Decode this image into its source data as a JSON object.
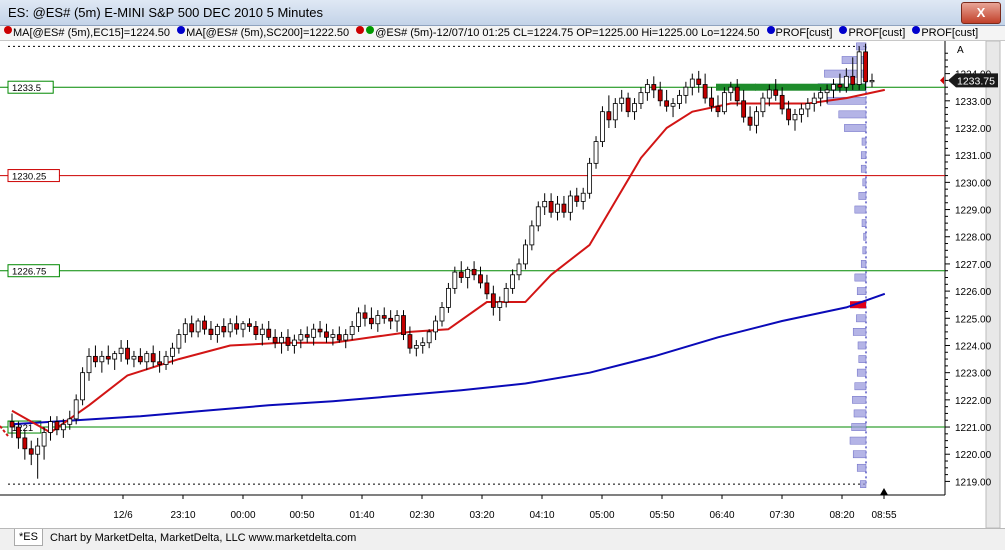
{
  "window": {
    "title": "ES: @ES# (5m) E-MINI S&P 500 DEC 2010 5 Minutes",
    "close_label": "X"
  },
  "legend": {
    "items": [
      {
        "color": "#cc0000",
        "text": "MA[@ES# (5m),EC15]=1224.50"
      },
      {
        "color": "#0000cc",
        "text": "MA[@ES# (5m),SC200]=1222.50"
      },
      {
        "color": "#cc0000",
        "color2": "#009900",
        "text": "@ES# (5m)-12/07/10 01:25 CL=1224.75 OP=1225.00 Hi=1225.00 Lo=1224.50"
      },
      {
        "color": "#0000cc",
        "text": "PROF[cust]"
      },
      {
        "color": "#0000cc",
        "text": "PROF[cust]"
      },
      {
        "color": "#0000cc",
        "text": "PROF[cust]"
      }
    ]
  },
  "status": {
    "tab_label": "*ES",
    "credit": "Chart by MarketDelta, MarketDelta, LLC www.marketdelta.com"
  },
  "chart_data": {
    "type": "candlestick",
    "y_tick_labels": [
      "1219.00",
      "1220.00",
      "1221.00",
      "1222.00",
      "1223.00",
      "1224.00",
      "1225.00",
      "1226.00",
      "1227.00",
      "1228.00",
      "1229.00",
      "1230.00",
      "1231.00",
      "1232.00",
      "1233.00",
      "1234.00"
    ],
    "ylim": [
      1218.5,
      1235.2
    ],
    "x_tick_labels": [
      "12/6",
      "23:10",
      "00:00",
      "00:50",
      "01:40",
      "02:30",
      "03:20",
      "04:10",
      "05:00",
      "05:50",
      "06:40",
      "07:30",
      "08:20",
      "08:55"
    ],
    "current_price": "1233.75",
    "corner_label": "A",
    "horizontal_levels": [
      {
        "label": "1233.5",
        "value": 1233.5,
        "color": "#008800"
      },
      {
        "label": "1230.25",
        "value": 1230.25,
        "color": "#cc0000"
      },
      {
        "label": "1226.75",
        "value": 1226.75,
        "color": "#008800"
      },
      {
        "label": "1221",
        "value": 1221.0,
        "color": "#008800"
      }
    ],
    "dotted_levels": [
      1218.9,
      1235.0
    ],
    "candles": [
      [
        1221.2,
        1221.5,
        1220.6,
        1221.0
      ],
      [
        1221.0,
        1221.2,
        1220.2,
        1220.6
      ],
      [
        1220.6,
        1220.9,
        1219.8,
        1220.2
      ],
      [
        1220.2,
        1220.5,
        1219.6,
        1220.0
      ],
      [
        1220.0,
        1220.6,
        1219.1,
        1220.3
      ],
      [
        1220.3,
        1221.0,
        1219.8,
        1220.8
      ],
      [
        1220.8,
        1221.4,
        1220.5,
        1221.2
      ],
      [
        1221.2,
        1221.4,
        1220.7,
        1220.9
      ],
      [
        1220.9,
        1221.3,
        1220.6,
        1221.1
      ],
      [
        1221.1,
        1221.6,
        1220.9,
        1221.3
      ],
      [
        1221.3,
        1222.2,
        1221.1,
        1222.0
      ],
      [
        1222.0,
        1223.2,
        1221.8,
        1223.0
      ],
      [
        1223.0,
        1223.9,
        1222.7,
        1223.6
      ],
      [
        1223.6,
        1224.0,
        1223.2,
        1223.4
      ],
      [
        1223.4,
        1223.8,
        1223.0,
        1223.6
      ],
      [
        1223.6,
        1224.0,
        1223.3,
        1223.5
      ],
      [
        1223.5,
        1223.8,
        1223.1,
        1223.7
      ],
      [
        1223.7,
        1224.2,
        1223.4,
        1223.9
      ],
      [
        1223.9,
        1224.2,
        1223.3,
        1223.5
      ],
      [
        1223.5,
        1223.8,
        1223.2,
        1223.6
      ],
      [
        1223.6,
        1223.9,
        1223.3,
        1223.4
      ],
      [
        1223.4,
        1223.8,
        1223.1,
        1223.7
      ],
      [
        1223.7,
        1224.0,
        1223.2,
        1223.4
      ],
      [
        1223.4,
        1223.8,
        1223.0,
        1223.3
      ],
      [
        1223.3,
        1223.8,
        1223.1,
        1223.6
      ],
      [
        1223.6,
        1224.1,
        1223.3,
        1223.9
      ],
      [
        1223.9,
        1224.6,
        1223.7,
        1224.4
      ],
      [
        1224.4,
        1225.0,
        1224.1,
        1224.8
      ],
      [
        1224.8,
        1225.1,
        1224.3,
        1224.5
      ],
      [
        1224.5,
        1225.0,
        1224.3,
        1224.9
      ],
      [
        1224.9,
        1225.1,
        1224.4,
        1224.6
      ],
      [
        1224.6,
        1224.9,
        1224.2,
        1224.4
      ],
      [
        1224.4,
        1224.8,
        1224.1,
        1224.7
      ],
      [
        1224.7,
        1225.0,
        1224.3,
        1224.5
      ],
      [
        1224.5,
        1225.0,
        1224.3,
        1224.8
      ],
      [
        1224.8,
        1225.1,
        1224.4,
        1224.6
      ],
      [
        1224.6,
        1224.9,
        1224.3,
        1224.8
      ],
      [
        1224.8,
        1225.0,
        1224.5,
        1224.7
      ],
      [
        1224.7,
        1224.9,
        1224.2,
        1224.4
      ],
      [
        1224.4,
        1224.8,
        1224.0,
        1224.6
      ],
      [
        1224.6,
        1224.9,
        1224.2,
        1224.3
      ],
      [
        1224.3,
        1224.6,
        1223.9,
        1224.1
      ],
      [
        1224.1,
        1224.5,
        1223.7,
        1224.3
      ],
      [
        1224.3,
        1224.6,
        1223.8,
        1224.0
      ],
      [
        1224.0,
        1224.4,
        1223.7,
        1224.2
      ],
      [
        1224.2,
        1224.6,
        1223.9,
        1224.4
      ],
      [
        1224.4,
        1224.7,
        1224.1,
        1224.3
      ],
      [
        1224.3,
        1224.8,
        1224.0,
        1224.6
      ],
      [
        1224.6,
        1224.9,
        1224.3,
        1224.5
      ],
      [
        1224.5,
        1224.8,
        1224.1,
        1224.3
      ],
      [
        1224.3,
        1224.6,
        1224.0,
        1224.4
      ],
      [
        1224.4,
        1224.7,
        1224.1,
        1224.2
      ],
      [
        1224.2,
        1224.6,
        1223.9,
        1224.4
      ],
      [
        1224.4,
        1224.9,
        1224.2,
        1224.7
      ],
      [
        1224.7,
        1225.4,
        1224.5,
        1225.2
      ],
      [
        1225.2,
        1225.5,
        1224.7,
        1225.0
      ],
      [
        1225.0,
        1225.4,
        1224.6,
        1224.8
      ],
      [
        1224.8,
        1225.3,
        1224.5,
        1225.1
      ],
      [
        1225.1,
        1225.4,
        1224.8,
        1225.0
      ],
      [
        1225.0,
        1225.3,
        1224.6,
        1224.9
      ],
      [
        1224.9,
        1225.3,
        1224.5,
        1225.1
      ],
      [
        1225.1,
        1225.3,
        1224.2,
        1224.4
      ],
      [
        1224.4,
        1224.7,
        1223.7,
        1223.9
      ],
      [
        1223.9,
        1224.2,
        1223.6,
        1224.0
      ],
      [
        1224.0,
        1224.3,
        1223.7,
        1224.1
      ],
      [
        1224.1,
        1224.6,
        1223.9,
        1224.5
      ],
      [
        1224.5,
        1225.1,
        1224.2,
        1224.9
      ],
      [
        1224.9,
        1225.6,
        1224.7,
        1225.4
      ],
      [
        1225.4,
        1226.3,
        1225.2,
        1226.1
      ],
      [
        1226.1,
        1226.9,
        1225.9,
        1226.7
      ],
      [
        1226.7,
        1227.1,
        1226.3,
        1226.5
      ],
      [
        1226.5,
        1226.9,
        1226.1,
        1226.8
      ],
      [
        1226.8,
        1227.1,
        1226.4,
        1226.6
      ],
      [
        1226.6,
        1226.9,
        1226.1,
        1226.3
      ],
      [
        1226.3,
        1226.6,
        1225.7,
        1225.9
      ],
      [
        1225.9,
        1226.2,
        1225.1,
        1225.4
      ],
      [
        1225.4,
        1225.8,
        1224.9,
        1225.6
      ],
      [
        1225.6,
        1226.3,
        1225.4,
        1226.1
      ],
      [
        1226.1,
        1226.8,
        1225.9,
        1226.6
      ],
      [
        1226.6,
        1227.2,
        1226.4,
        1227.0
      ],
      [
        1227.0,
        1227.9,
        1226.8,
        1227.7
      ],
      [
        1227.7,
        1228.6,
        1227.5,
        1228.4
      ],
      [
        1228.4,
        1229.3,
        1228.2,
        1229.1
      ],
      [
        1229.1,
        1229.6,
        1228.8,
        1229.3
      ],
      [
        1229.3,
        1229.6,
        1228.7,
        1228.9
      ],
      [
        1228.9,
        1229.5,
        1228.6,
        1229.2
      ],
      [
        1229.2,
        1229.5,
        1228.7,
        1228.9
      ],
      [
        1228.9,
        1229.7,
        1228.6,
        1229.5
      ],
      [
        1229.5,
        1229.8,
        1229.1,
        1229.3
      ],
      [
        1229.3,
        1229.8,
        1229.0,
        1229.6
      ],
      [
        1229.6,
        1230.9,
        1229.4,
        1230.7
      ],
      [
        1230.7,
        1231.7,
        1230.5,
        1231.5
      ],
      [
        1231.5,
        1232.8,
        1231.3,
        1232.6
      ],
      [
        1232.6,
        1233.2,
        1232.0,
        1232.3
      ],
      [
        1232.3,
        1233.1,
        1232.0,
        1232.9
      ],
      [
        1232.9,
        1233.4,
        1232.6,
        1233.1
      ],
      [
        1233.1,
        1233.3,
        1232.4,
        1232.6
      ],
      [
        1232.6,
        1233.1,
        1232.3,
        1232.9
      ],
      [
        1232.9,
        1233.5,
        1232.7,
        1233.3
      ],
      [
        1233.3,
        1233.8,
        1233.0,
        1233.6
      ],
      [
        1233.6,
        1233.9,
        1233.1,
        1233.4
      ],
      [
        1233.4,
        1233.7,
        1232.8,
        1233.0
      ],
      [
        1233.0,
        1233.4,
        1232.6,
        1232.8
      ],
      [
        1232.8,
        1233.1,
        1232.4,
        1232.9
      ],
      [
        1232.9,
        1233.4,
        1232.7,
        1233.2
      ],
      [
        1233.2,
        1233.7,
        1232.9,
        1233.5
      ],
      [
        1233.5,
        1234.0,
        1233.2,
        1233.8
      ],
      [
        1233.8,
        1234.1,
        1233.3,
        1233.6
      ],
      [
        1233.6,
        1234.0,
        1232.9,
        1233.1
      ],
      [
        1233.1,
        1233.5,
        1232.6,
        1232.8
      ],
      [
        1232.8,
        1233.2,
        1232.4,
        1232.6
      ],
      [
        1232.6,
        1233.5,
        1232.5,
        1233.3
      ],
      [
        1233.3,
        1233.7,
        1233.0,
        1233.5
      ],
      [
        1233.5,
        1233.8,
        1232.8,
        1233.0
      ],
      [
        1233.0,
        1233.4,
        1232.2,
        1232.4
      ],
      [
        1232.4,
        1232.8,
        1231.9,
        1232.1
      ],
      [
        1232.1,
        1232.8,
        1231.8,
        1232.6
      ],
      [
        1232.6,
        1233.3,
        1232.4,
        1233.1
      ],
      [
        1233.1,
        1233.6,
        1232.8,
        1233.4
      ],
      [
        1233.4,
        1233.8,
        1233.0,
        1233.2
      ],
      [
        1233.2,
        1233.5,
        1232.5,
        1232.7
      ],
      [
        1232.7,
        1233.0,
        1232.1,
        1232.3
      ],
      [
        1232.3,
        1232.7,
        1231.9,
        1232.5
      ],
      [
        1232.5,
        1232.9,
        1232.2,
        1232.7
      ],
      [
        1232.7,
        1233.1,
        1232.4,
        1232.9
      ],
      [
        1232.9,
        1233.3,
        1232.6,
        1233.1
      ],
      [
        1233.1,
        1233.5,
        1232.8,
        1233.3
      ],
      [
        1233.3,
        1233.6,
        1232.9,
        1233.4
      ],
      [
        1233.4,
        1233.8,
        1233.1,
        1233.6
      ],
      [
        1233.6,
        1234.0,
        1233.3,
        1233.5
      ],
      [
        1233.5,
        1234.2,
        1233.3,
        1233.9
      ],
      [
        1233.9,
        1234.6,
        1233.4,
        1233.6
      ],
      [
        1233.6,
        1235.0,
        1233.4,
        1234.8
      ],
      [
        1234.8,
        1235.1,
        1233.4,
        1233.7
      ],
      [
        1233.7,
        1234.0,
        1233.5,
        1233.75
      ]
    ],
    "ma15": [
      [
        0,
        1221.6
      ],
      [
        6,
        1220.8
      ],
      [
        12,
        1221.8
      ],
      [
        18,
        1222.9
      ],
      [
        26,
        1223.5
      ],
      [
        34,
        1224.0
      ],
      [
        42,
        1224.1
      ],
      [
        50,
        1224.1
      ],
      [
        56,
        1224.3
      ],
      [
        62,
        1224.5
      ],
      [
        68,
        1224.6
      ],
      [
        74,
        1225.6
      ],
      [
        80,
        1225.6
      ],
      [
        84,
        1226.6
      ],
      [
        90,
        1227.7
      ],
      [
        94,
        1229.3
      ],
      [
        98,
        1230.9
      ],
      [
        102,
        1232.0
      ],
      [
        106,
        1232.6
      ],
      [
        112,
        1232.9
      ],
      [
        118,
        1232.9
      ],
      [
        124,
        1232.9
      ],
      [
        130,
        1233.1
      ],
      [
        136,
        1233.4
      ]
    ],
    "ma200": [
      [
        0,
        1221.1
      ],
      [
        10,
        1221.25
      ],
      [
        20,
        1221.4
      ],
      [
        30,
        1221.6
      ],
      [
        40,
        1221.8
      ],
      [
        50,
        1221.95
      ],
      [
        60,
        1222.15
      ],
      [
        70,
        1222.35
      ],
      [
        80,
        1222.6
      ],
      [
        90,
        1223.0
      ],
      [
        100,
        1223.6
      ],
      [
        110,
        1224.3
      ],
      [
        120,
        1224.9
      ],
      [
        130,
        1225.4
      ],
      [
        136,
        1225.9
      ]
    ],
    "volume_profile": [
      [
        1218.9,
        0.35
      ],
      [
        1219.5,
        0.55
      ],
      [
        1220.0,
        0.8
      ],
      [
        1220.5,
        1.0
      ],
      [
        1221.0,
        0.9
      ],
      [
        1221.5,
        0.75
      ],
      [
        1222.0,
        0.85
      ],
      [
        1222.5,
        0.7
      ],
      [
        1223.0,
        0.55
      ],
      [
        1223.5,
        0.45
      ],
      [
        1224.0,
        0.5
      ],
      [
        1224.5,
        0.8
      ],
      [
        1225.0,
        0.6
      ],
      [
        1225.5,
        0.45
      ],
      [
        1226.0,
        0.55
      ],
      [
        1226.5,
        0.7
      ],
      [
        1227.0,
        0.3
      ],
      [
        1227.5,
        0.2
      ],
      [
        1228.0,
        0.15
      ],
      [
        1228.5,
        0.25
      ],
      [
        1229.0,
        0.7
      ],
      [
        1229.5,
        0.45
      ],
      [
        1230.0,
        0.2
      ],
      [
        1230.5,
        0.3
      ],
      [
        1231.0,
        0.3
      ],
      [
        1231.5,
        0.25
      ],
      [
        1232.0,
        1.35
      ],
      [
        1232.5,
        1.7
      ],
      [
        1233.0,
        2.4
      ],
      [
        1233.5,
        3.0
      ],
      [
        1234.0,
        2.6
      ],
      [
        1234.5,
        1.5
      ],
      [
        1235.0,
        0.6
      ]
    ],
    "profile_poc": 1233.5,
    "profile_marker": 1225.5
  }
}
